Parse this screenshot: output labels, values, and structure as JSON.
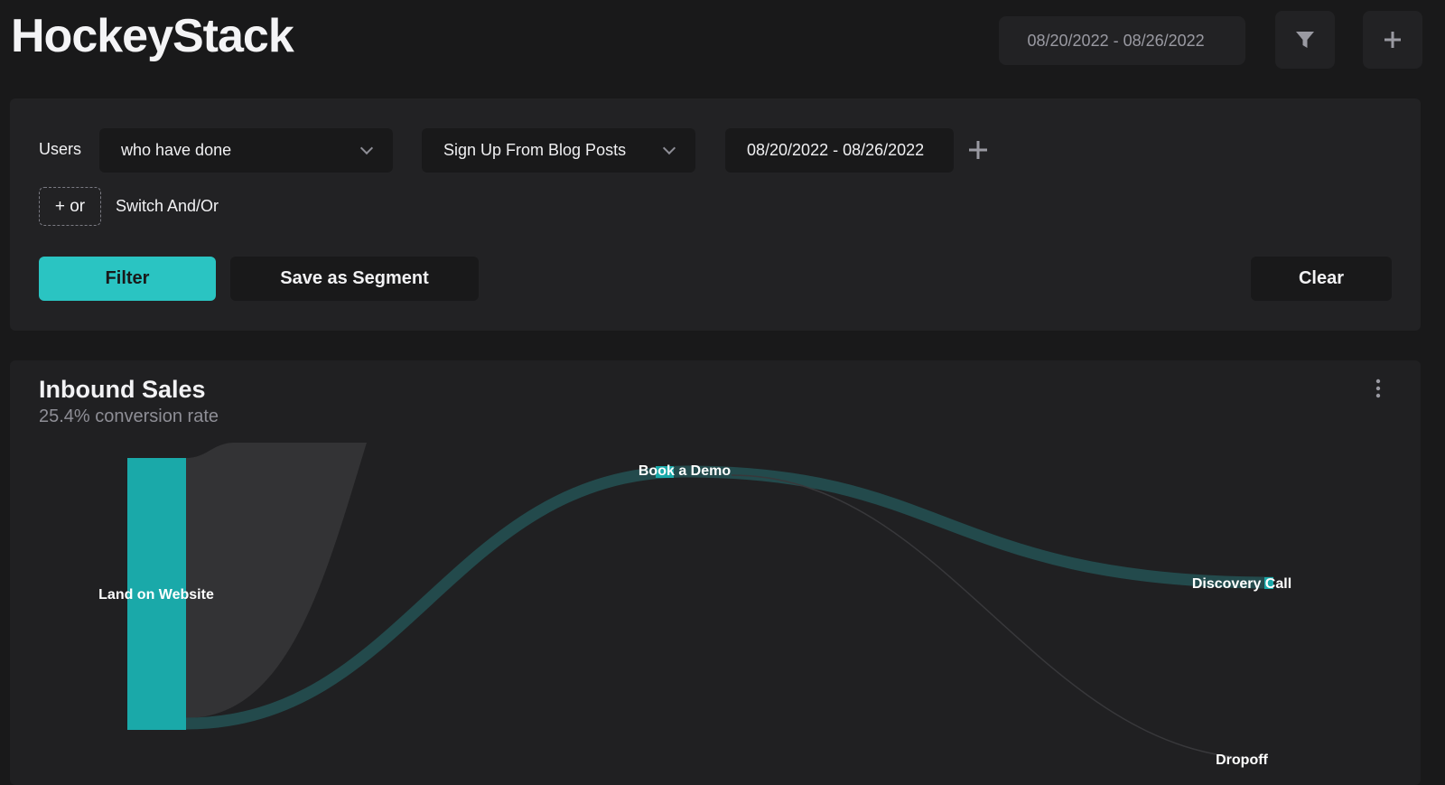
{
  "header": {
    "logo": "HockeyStack",
    "date_range": "08/20/2022 - 08/26/2022",
    "filter_icon": "filter-icon",
    "add_icon": "plus-icon"
  },
  "filter_panel": {
    "users_label": "Users",
    "condition": "who have done",
    "event": "Sign Up From Blog Posts",
    "date_range": "08/20/2022 - 08/26/2022",
    "or_button": "+ or",
    "switch_label": "Switch And/Or",
    "filter_button": "Filter",
    "save_button": "Save as Segment",
    "clear_button": "Clear"
  },
  "chart_card": {
    "title": "Inbound Sales",
    "subtitle": "25.4% conversion rate",
    "menu_icon": "more-vertical-icon"
  },
  "chart_data": {
    "type": "sankey",
    "nodes": [
      "Land on Website",
      "Book a Demo",
      "Discovery Call",
      "Dropoff"
    ],
    "links": [
      {
        "source": "Land on Website",
        "target": "Book a Demo"
      },
      {
        "source": "Book a Demo",
        "target": "Discovery Call"
      },
      {
        "source": "Book a Demo",
        "target": "Dropoff"
      }
    ],
    "colors": {
      "node": "#1aa9a9",
      "link": "#234a4c",
      "dropoff": "#333335"
    }
  }
}
